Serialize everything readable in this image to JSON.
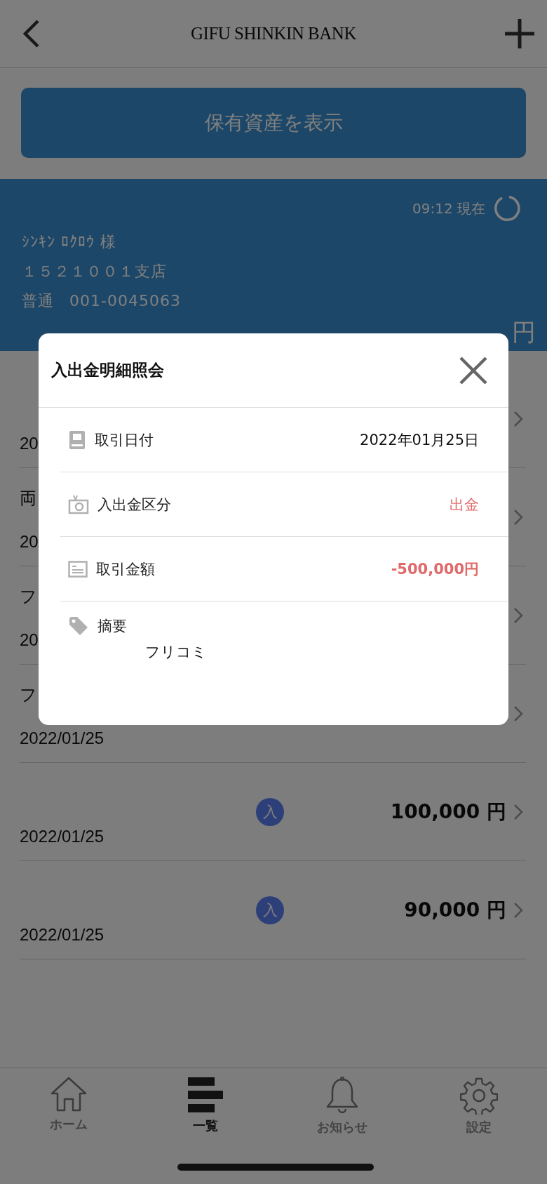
{
  "header": {
    "title": "GIFU SHINKIN BANK"
  },
  "assets_button": {
    "label": "保有資産を表示"
  },
  "account": {
    "updated": "09:12 現在",
    "holder": "ｼﾝｷﾝ ﾛｸﾛｳ 様",
    "branch": "１５２１００１支店",
    "type": "普通",
    "number": "001-0045063",
    "balance_unit": "円"
  },
  "transactions": [
    {
      "date": "20"
    },
    {
      "description": "両",
      "date": "20"
    },
    {
      "description": "フ",
      "date": "20"
    },
    {
      "description": "フ",
      "date": "2022/01/25"
    },
    {
      "badge": "入",
      "amount": "100,000 円",
      "date": "2022/01/25"
    },
    {
      "badge": "入",
      "amount": "90,000 円",
      "date": "2022/01/25"
    }
  ],
  "modal": {
    "title": "入出金明細照会",
    "rows": [
      {
        "kind": "date",
        "label": "取引日付",
        "value": "2022年01月25日",
        "highlight": false
      },
      {
        "kind": "type",
        "label": "入出金区分",
        "value": "出金",
        "highlight": true
      },
      {
        "kind": "amount",
        "label": "取引金額",
        "value": "-500,000円",
        "highlight": true
      },
      {
        "kind": "memo",
        "label": "摘要",
        "value": "フリコミ",
        "highlight": false
      }
    ]
  },
  "tab_bar": [
    {
      "kind": "home",
      "label": "ホーム",
      "selected": false
    },
    {
      "kind": "list",
      "label": "一覧",
      "selected": true
    },
    {
      "kind": "bell",
      "label": "お知らせ",
      "selected": false
    },
    {
      "kind": "settings",
      "label": "設定",
      "selected": false
    }
  ]
}
